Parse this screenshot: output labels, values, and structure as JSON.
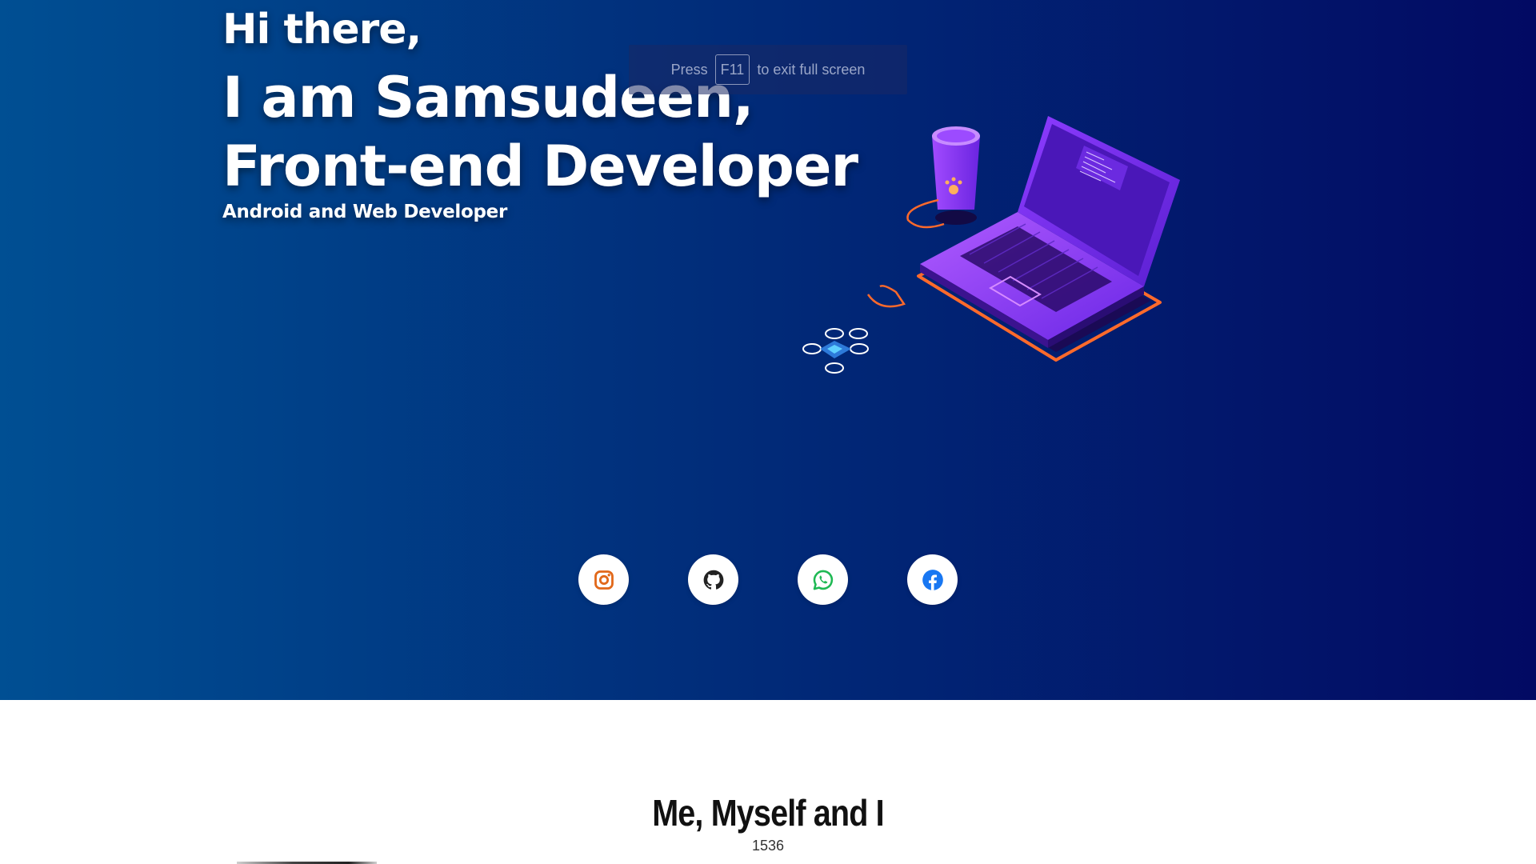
{
  "hero": {
    "greeting": "Hi there,",
    "name_line": "I am Samsudeen,",
    "role_line": "Front-end Developer",
    "subtitle": "Android and Web Developer"
  },
  "fullscreen_notice": {
    "prefix": "Press",
    "key": "F11",
    "suffix": "to exit full screen"
  },
  "social": [
    {
      "name": "instagram",
      "icon": "instagram-icon",
      "color": "#e1681a"
    },
    {
      "name": "github",
      "icon": "github-icon",
      "color": "#222222"
    },
    {
      "name": "whatsapp",
      "icon": "whatsapp-icon",
      "color": "#1fb954"
    },
    {
      "name": "facebook",
      "icon": "facebook-icon",
      "color": "#1877f2"
    }
  ],
  "about": {
    "title": "Me, Myself and I",
    "count": "1536"
  },
  "colors": {
    "hero_left": "#004f93",
    "hero_right": "#020a63",
    "laptop": "#7b2ff7",
    "accent_orange": "#ff6a2b"
  }
}
